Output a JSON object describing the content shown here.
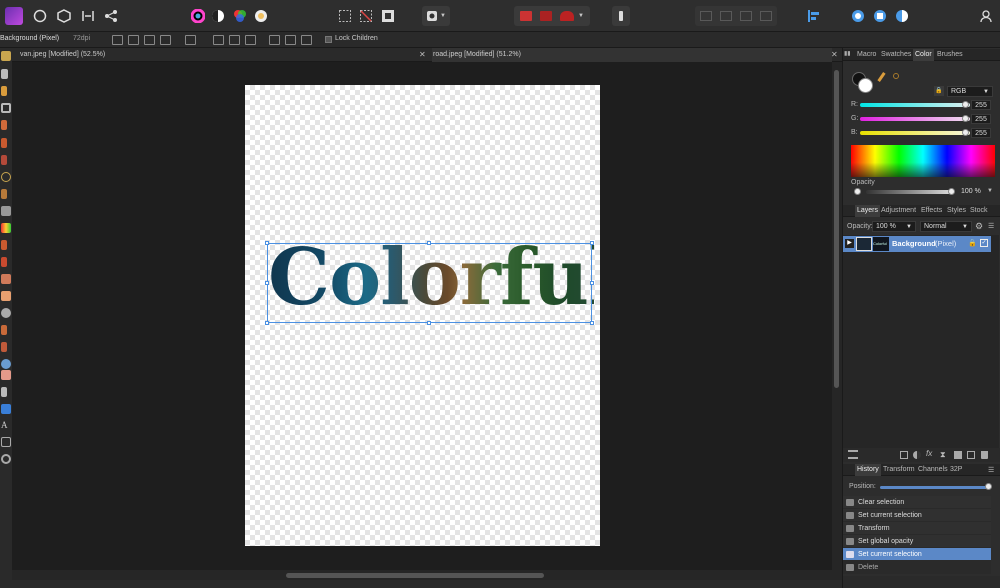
{
  "context_bar": {
    "layer_name": "Background (Pixel)",
    "dpi": "72dpi",
    "lock_children": "Lock Children"
  },
  "doc_tabs": [
    {
      "label": "van.jpeg [Modified] (52.5%)"
    },
    {
      "label": "road.jpeg [Modified] (51.2%)"
    }
  ],
  "canvas": {
    "text": "Colorful"
  },
  "color_panel": {
    "tabs": [
      "Macro",
      "Swatches",
      "Color",
      "Brushes"
    ],
    "active_tab": "Color",
    "model": "RGB",
    "r_label": "R:",
    "g_label": "G:",
    "b_label": "B:",
    "r": "255",
    "g": "255",
    "b": "255",
    "opacity_label": "Opacity",
    "opacity_value": "100 %"
  },
  "layers_panel": {
    "tabs": [
      "Layers",
      "Adjustment",
      "Effects",
      "Styles",
      "Stock"
    ],
    "active_tab": "Layers",
    "opacity_label": "Opacity:",
    "opacity_value": "100 %",
    "blend_mode": "Normal",
    "layer_thumb_text": "Colorful",
    "layer_name": "Background",
    "layer_type": "(Pixel)"
  },
  "history_panel": {
    "tabs": [
      "History",
      "Transform",
      "Channels",
      "32P"
    ],
    "active_tab": "History",
    "position_label": "Position:",
    "items": [
      {
        "label": "Clear selection"
      },
      {
        "label": "Set current selection"
      },
      {
        "label": "Transform"
      },
      {
        "label": "Set global opacity"
      },
      {
        "label": "Set current selection"
      },
      {
        "label": "Delete"
      }
    ]
  },
  "colors": {
    "accent": "#5b88c7",
    "selection": "#4a90e2"
  }
}
